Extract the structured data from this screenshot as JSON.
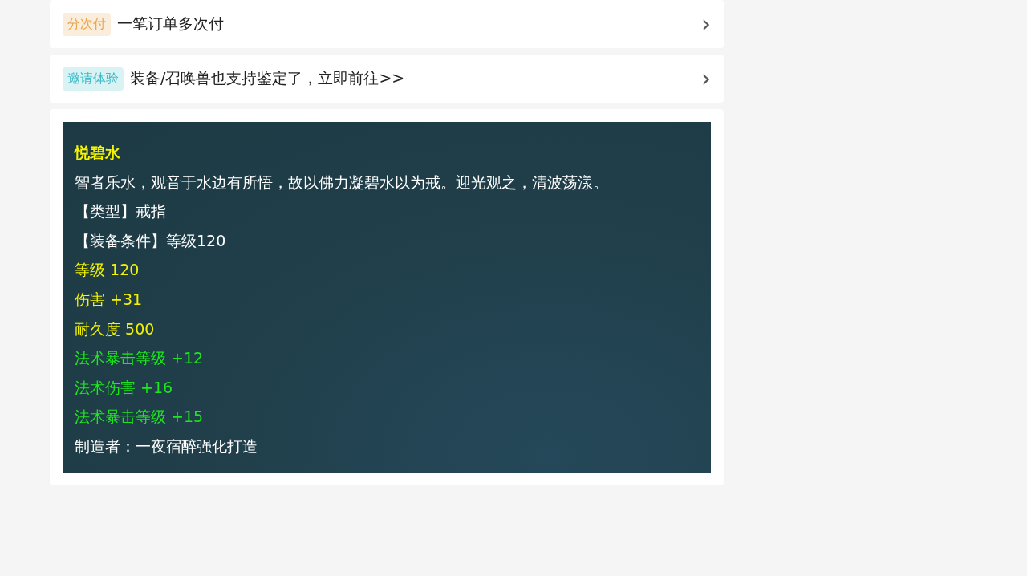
{
  "promos": [
    {
      "tag": {
        "text": "分次付",
        "color": "#e8a650"
      },
      "text": "一笔订单多次付",
      "chevron": "›"
    },
    {
      "tag": {
        "text": "邀请体验",
        "color": "#3fbcc8"
      },
      "text": "装备/召唤兽也支持鉴定了，立即前往>>",
      "chevron": "›"
    }
  ],
  "item_tooltip": {
    "lines": [
      {
        "kind": "title",
        "text": "悦碧水"
      },
      {
        "kind": "desc",
        "text": "智者乐水，观音于水边有所悟，故以佛力凝碧水以为戒。迎光观之，清波荡漾。"
      },
      {
        "kind": "desc",
        "text": "【类型】戒指"
      },
      {
        "kind": "desc",
        "text": "【装备条件】等级120"
      },
      {
        "kind": "base",
        "text": "等级 120"
      },
      {
        "kind": "base",
        "text": "伤害 +31"
      },
      {
        "kind": "base",
        "text": "耐久度 500"
      },
      {
        "kind": "magic",
        "text": "法术暴击等级 +12"
      },
      {
        "kind": "magic",
        "text": "法术伤害 +16"
      },
      {
        "kind": "magic",
        "text": "法术暴击等级 +15"
      },
      {
        "kind": "desc",
        "text": "制造者：一夜宿醉强化打造"
      }
    ]
  }
}
